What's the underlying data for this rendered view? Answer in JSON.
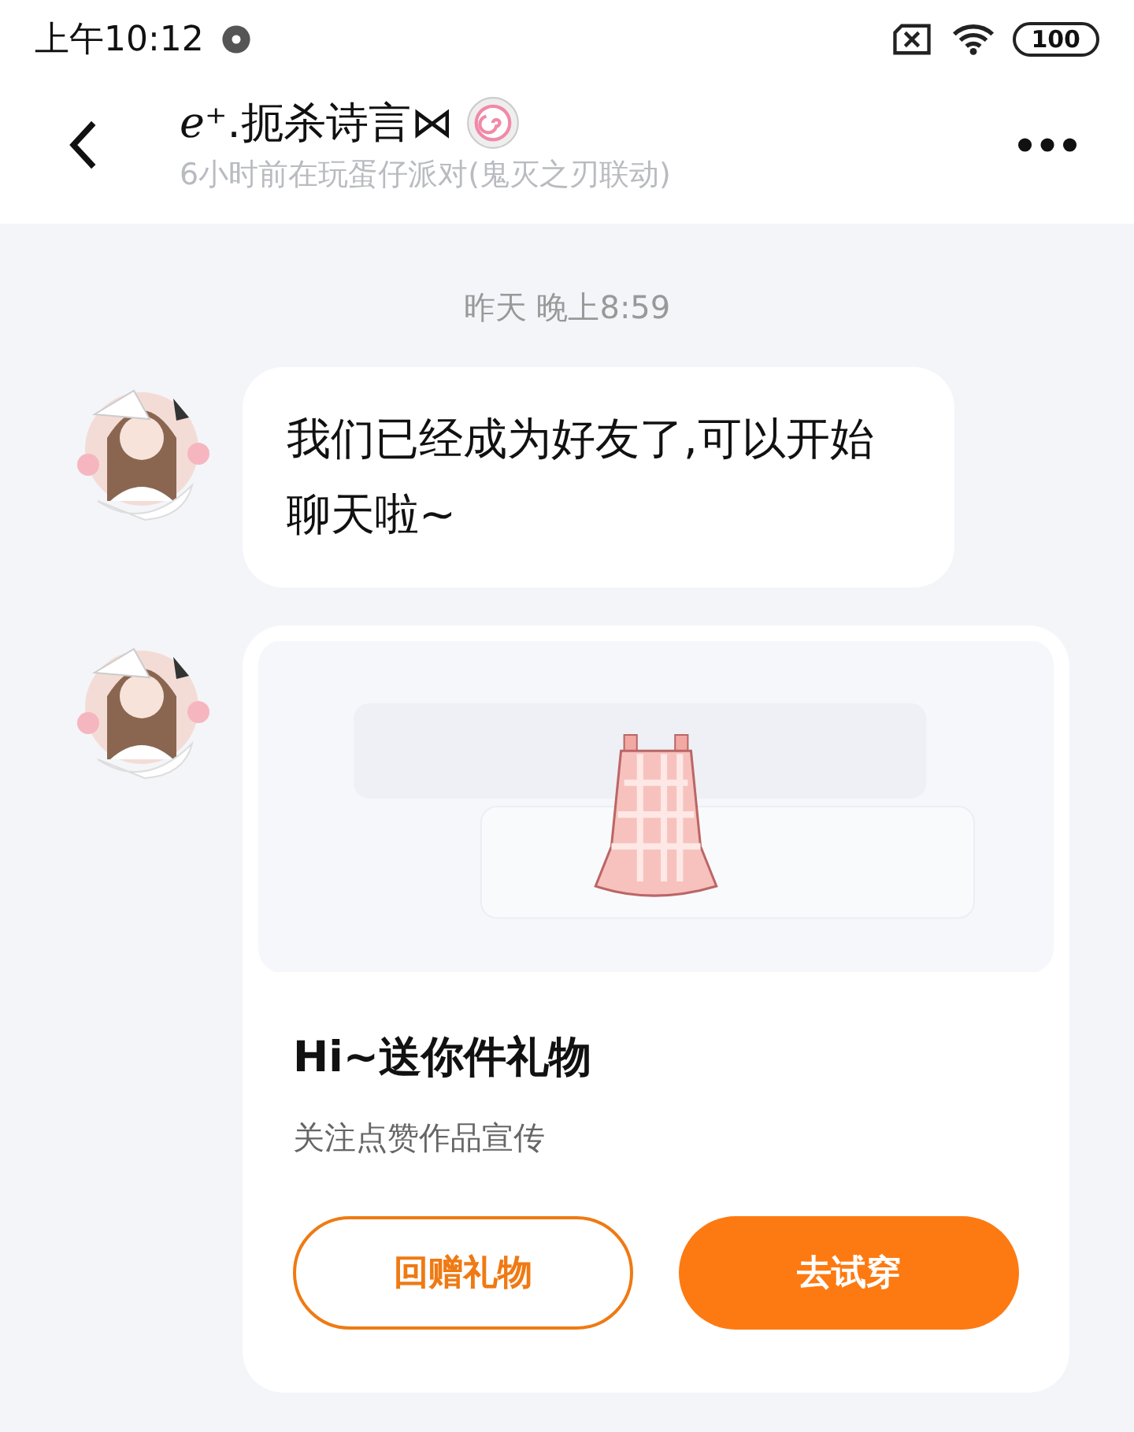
{
  "status_bar": {
    "time": "上午10:12",
    "battery": "100"
  },
  "header": {
    "title": "ℯ⁺.扼杀诗言⋈",
    "subtitle": "6小时前在玩蛋仔派对(鬼灭之刃联动)"
  },
  "messages": [
    {
      "kind": "text",
      "time": "昨天 晚上8:59",
      "text": "我们已经成为好友了,可以开始聊天啦~"
    },
    {
      "kind": "gift",
      "title": "Hi~送你件礼物",
      "subtitle": "关注点赞作品宣传",
      "buttons": [
        {
          "label": "回赠礼物",
          "kind": "outline"
        },
        {
          "label": "去试穿",
          "kind": "filled"
        }
      ]
    }
  ]
}
